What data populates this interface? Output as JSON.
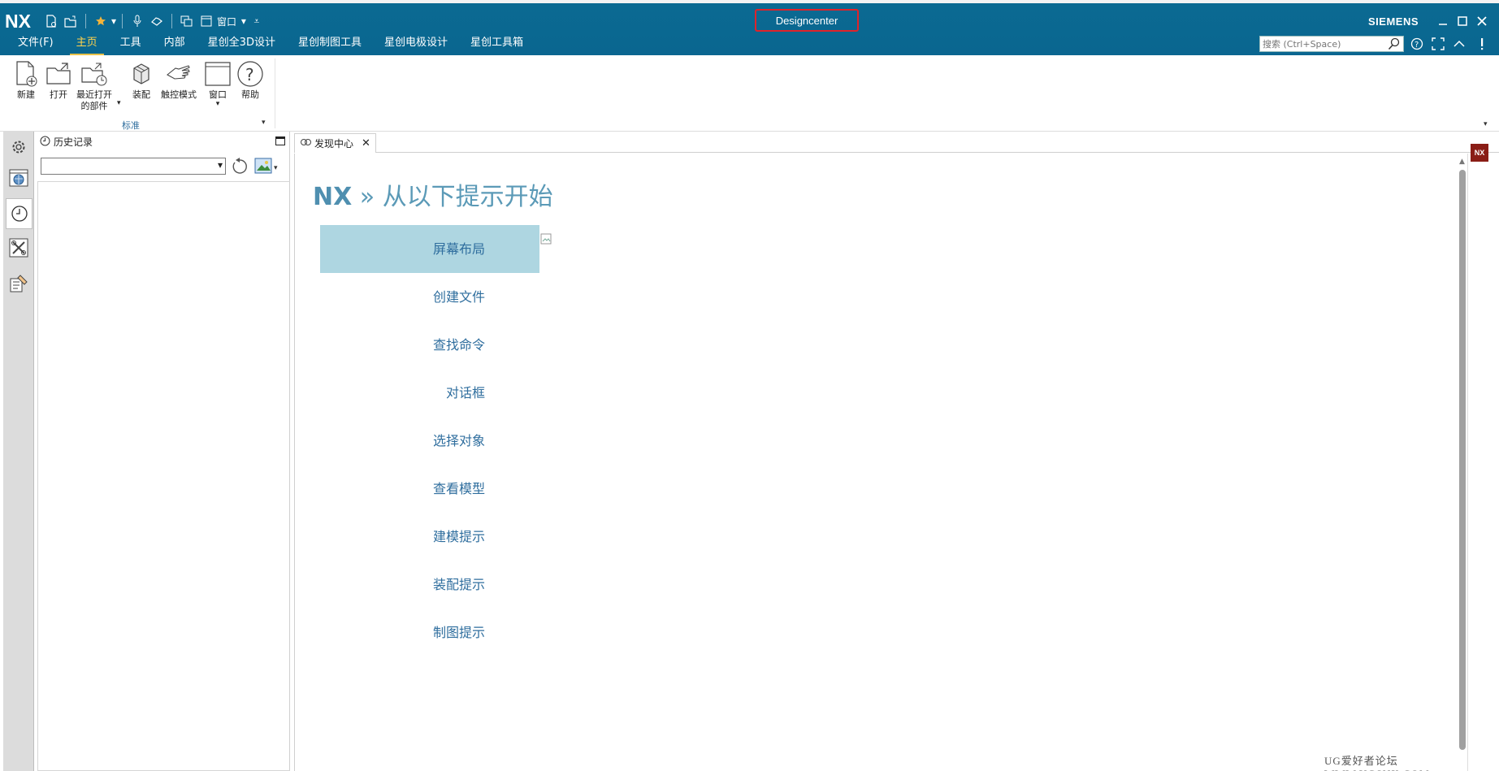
{
  "app": {
    "logo": "NX",
    "window_title": "Designcenter",
    "brand": "SIEMENS",
    "qat": {
      "window_label": "窗口"
    }
  },
  "menu": {
    "tabs": [
      {
        "label": "文件(F)"
      },
      {
        "label": "主页",
        "active": true
      },
      {
        "label": "工具"
      },
      {
        "label": "内部"
      },
      {
        "label": "星创全3D设计"
      },
      {
        "label": "星创制图工具"
      },
      {
        "label": "星创电极设计"
      },
      {
        "label": "星创工具箱"
      }
    ],
    "search_placeholder": "搜索 (Ctrl+Space)"
  },
  "ribbon": {
    "buttons": [
      {
        "label": "新建",
        "icon": "new-file-icon"
      },
      {
        "label": "打开",
        "icon": "open-folder-icon"
      },
      {
        "label": "最近打开\n的部件",
        "icon": "recent-parts-icon"
      },
      {
        "label": "装配",
        "icon": "assembly-icon"
      },
      {
        "label": "触控模式",
        "icon": "touch-mode-icon"
      },
      {
        "label": "窗口",
        "icon": "window-icon"
      },
      {
        "label": "帮助",
        "icon": "help-icon"
      }
    ],
    "group_label": "标准"
  },
  "history_panel": {
    "title": "历史记录"
  },
  "doc_tab": {
    "label": "发现中心"
  },
  "content": {
    "heading_prefix": "NX",
    "heading_sep": " » ",
    "heading_text": "从以下提示开始",
    "nav_items": [
      {
        "label": "屏幕布局",
        "active": true
      },
      {
        "label": "创建文件"
      },
      {
        "label": "查找命令"
      },
      {
        "label": "对话框"
      },
      {
        "label": "选择对象"
      },
      {
        "label": "查看模型"
      },
      {
        "label": "建模提示"
      },
      {
        "label": "装配提示"
      },
      {
        "label": "制图提示"
      }
    ]
  },
  "badge": "NX",
  "watermark": "UG爱好者论坛 WWW.UGSNX.COM",
  "colors": {
    "titlebar": "#0b6a92",
    "active_tab": "#ffd34d",
    "nav_active_bg": "#aed6e1",
    "nav_text": "#2f6e9e",
    "title_highlight": "#e0232a"
  }
}
